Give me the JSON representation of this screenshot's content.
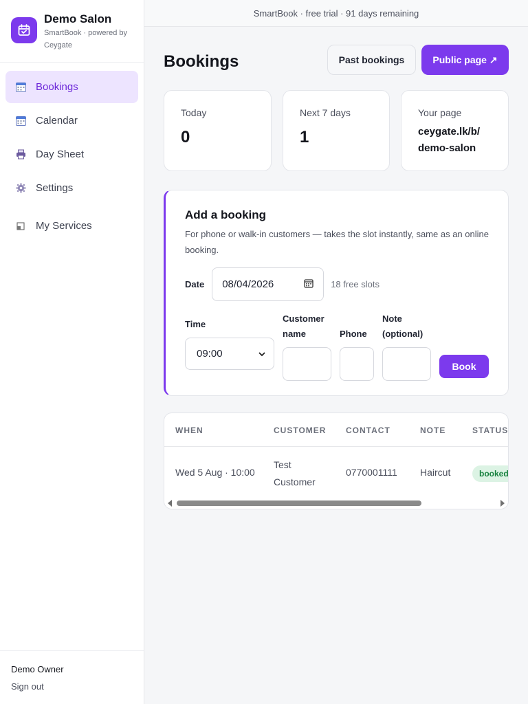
{
  "banner": {
    "text": "SmartBook · free trial · 91 days remaining"
  },
  "brand": {
    "name": "Demo Salon",
    "subtitle": "SmartBook · powered by Ceygate"
  },
  "nav": {
    "items": [
      {
        "label": "Bookings",
        "icon": "calendar-grid-icon",
        "active": true
      },
      {
        "label": "Calendar",
        "icon": "calendar-grid-icon",
        "active": false
      },
      {
        "label": "Day Sheet",
        "icon": "printer-icon",
        "active": false
      },
      {
        "label": "Settings",
        "icon": "gear-icon",
        "active": false
      }
    ],
    "secondary": {
      "label": "My Services",
      "icon": "window-icon"
    }
  },
  "user": {
    "name": "Demo Owner",
    "sign_out": "Sign out"
  },
  "page": {
    "title": "Bookings",
    "past_bookings_label": "Past bookings",
    "public_page_label": "Public page ↗"
  },
  "stats": {
    "today": {
      "label": "Today",
      "value": "0"
    },
    "next7": {
      "label": "Next 7 days",
      "value": "1"
    },
    "your_page": {
      "label": "Your page",
      "value": "ceygate.lk/b/ demo-salon"
    }
  },
  "add_booking": {
    "title": "Add a booking",
    "description": "For phone or walk-in customers — takes the slot instantly, same as an online booking.",
    "date_label": "Date",
    "date_value": "08/04/2026",
    "free_slots": "18 free slots",
    "time_label": "Time",
    "time_value": "09:00",
    "customer_name_label": "Customer name",
    "phone_label": "Phone",
    "note_label": "Note (optional)",
    "book_label": "Book"
  },
  "table": {
    "headers": [
      "WHEN",
      "CUSTOMER",
      "CONTACT",
      "NOTE",
      "STATUS"
    ],
    "rows": [
      {
        "when": "Wed 5 Aug · 10:00",
        "customer": "Test Customer",
        "contact": "0770001111",
        "note": "Haircut",
        "status": "booked"
      }
    ]
  },
  "colors": {
    "accent": "#7c3aed",
    "accent_soft": "#ede4ff",
    "status_booked_bg": "#dcf3e4",
    "status_booked_fg": "#15803d"
  }
}
